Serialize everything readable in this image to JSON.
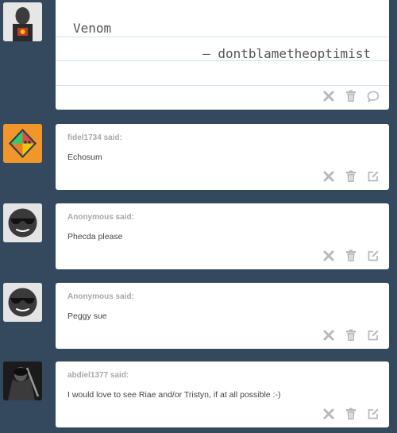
{
  "note": {
    "title": "Venom",
    "attribution": "— dontblametheoptimist"
  },
  "comments": [
    {
      "author": "fidel1734 said:",
      "message": "Echosum"
    },
    {
      "author": "Anonymous said:",
      "message": "Phecda please"
    },
    {
      "author": "Anonymous said:",
      "message": "Peggy sue"
    },
    {
      "author": "abdiel1377 said:",
      "message": "I would love to see Riae and/or Tristyn, if at all possible :-)"
    }
  ],
  "icons": {
    "delete": "x-icon",
    "trash": "trash-icon",
    "reply": "speech-bubble-icon",
    "edit": "edit-icon"
  },
  "colors": {
    "background": "#34495e",
    "card": "#ffffff",
    "icon": "#b9b9b9",
    "author": "#a8a8a8"
  }
}
